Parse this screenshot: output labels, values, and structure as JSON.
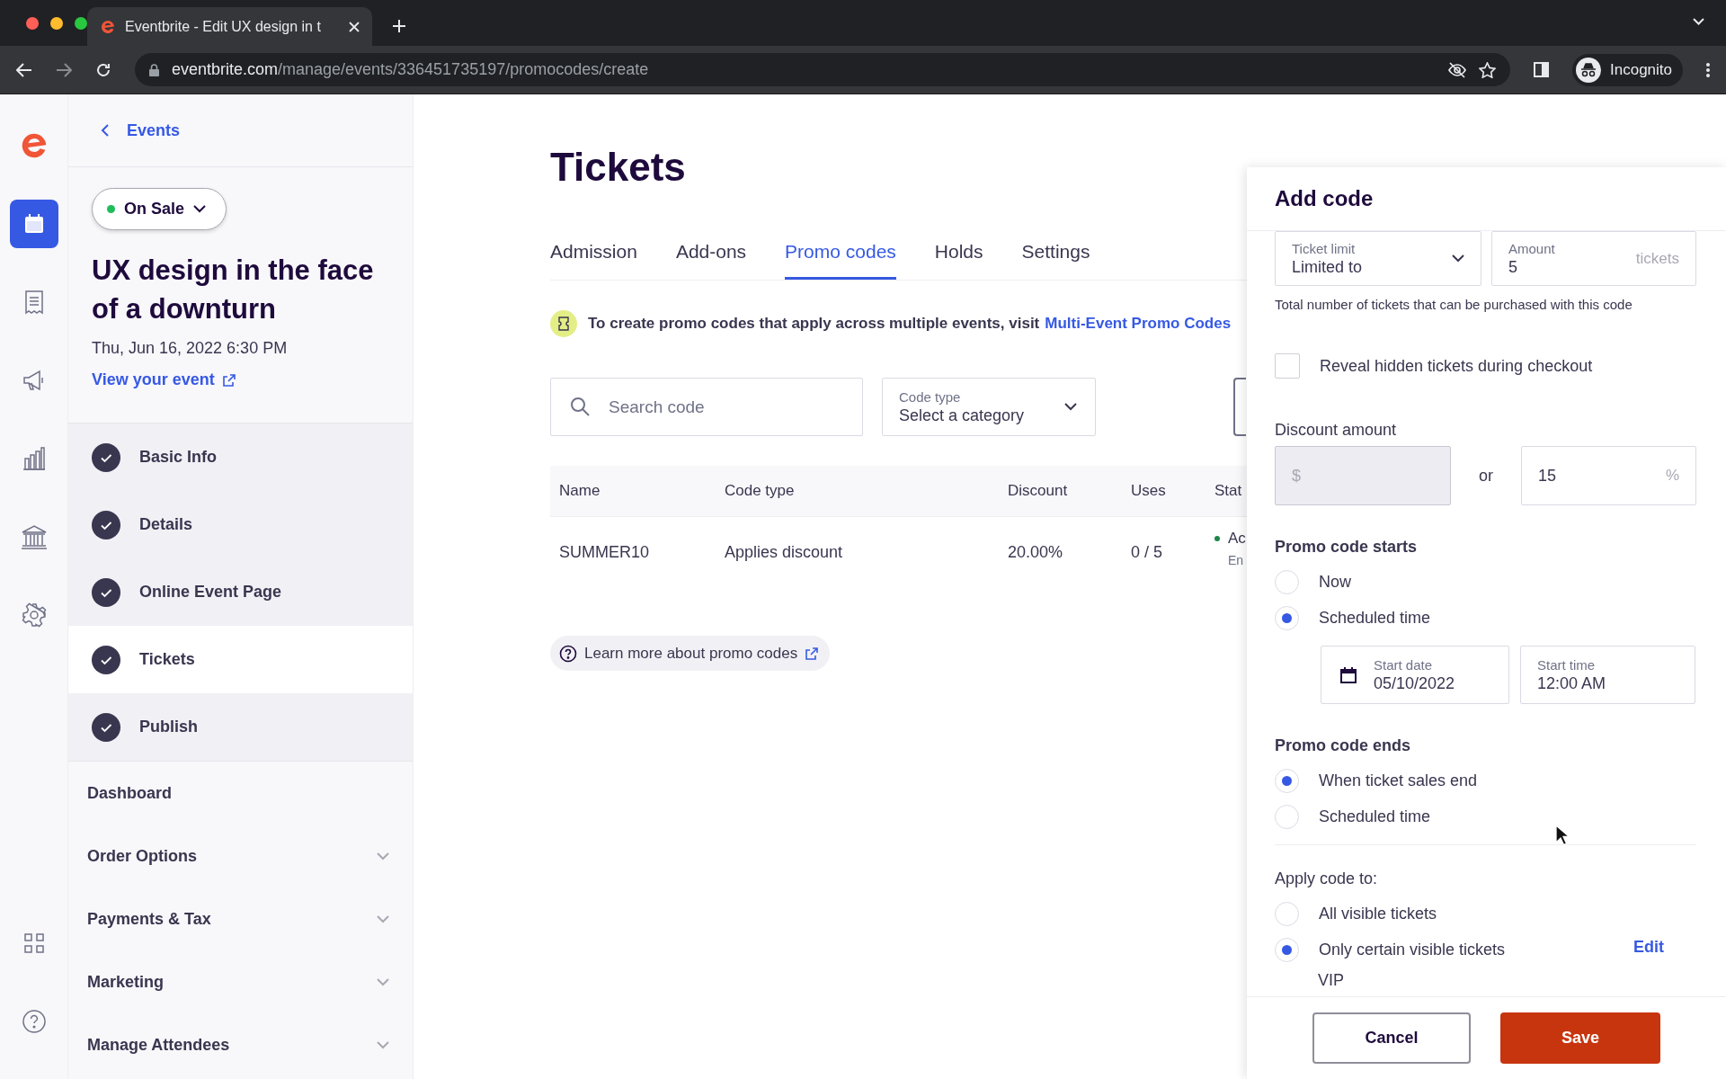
{
  "browser": {
    "tab_title": "Eventbrite - Edit UX design in t",
    "url_host": "eventbrite.com",
    "url_path": "/manage/events/336451735197/promocodes/create",
    "profile": "Incognito"
  },
  "rail": {
    "top": [
      {
        "kind": "calendar",
        "selected": true
      },
      {
        "kind": "receipt",
        "selected": false
      },
      {
        "kind": "megaphone",
        "selected": false
      },
      {
        "kind": "chart",
        "selected": false
      },
      {
        "kind": "bank",
        "selected": false
      },
      {
        "kind": "gear",
        "selected": false
      }
    ],
    "bottom": [
      {
        "kind": "grid",
        "selected": false
      },
      {
        "kind": "help",
        "selected": false
      }
    ]
  },
  "sidebar": {
    "back_link": "Events",
    "status": "On Sale",
    "event_title": "UX design in the face of a downturn",
    "event_date": "Thu, Jun 16, 2022 6:30 PM",
    "view_link": "View your event",
    "steps": [
      {
        "label": "Basic Info",
        "done": true,
        "selected": false
      },
      {
        "label": "Details",
        "done": true,
        "selected": false
      },
      {
        "label": "Online Event Page",
        "done": true,
        "selected": false
      },
      {
        "label": "Tickets",
        "done": true,
        "selected": true
      },
      {
        "label": "Publish",
        "done": true,
        "selected": false
      }
    ],
    "menu": [
      {
        "label": "Dashboard",
        "expandable": false
      },
      {
        "label": "Order Options",
        "expandable": true
      },
      {
        "label": "Payments & Tax",
        "expandable": true
      },
      {
        "label": "Marketing",
        "expandable": true
      },
      {
        "label": "Manage Attendees",
        "expandable": true
      }
    ]
  },
  "main": {
    "title": "Tickets",
    "tabs": [
      {
        "label": "Admission",
        "selected": false
      },
      {
        "label": "Add-ons",
        "selected": false
      },
      {
        "label": "Promo codes",
        "selected": true
      },
      {
        "label": "Holds",
        "selected": false
      },
      {
        "label": "Settings",
        "selected": false
      }
    ],
    "notice": {
      "text": "To create promo codes that apply across multiple events, visit",
      "link": "Multi-Event Promo Codes"
    },
    "search": {
      "placeholder": "Search code"
    },
    "code_type": {
      "label": "Code type",
      "value": "Select a category"
    },
    "table": {
      "columns": [
        "Name",
        "Code type",
        "Discount",
        "Uses",
        "Stat"
      ],
      "rows": [
        {
          "cells": [
            "SUMMER10",
            "Applies discount",
            "20.00%",
            "0 / 5"
          ],
          "status": "Ac",
          "status_sub": "En"
        }
      ]
    },
    "learn_more": "Learn more about promo codes"
  },
  "panel": {
    "title": "Add code",
    "ticket_limit": {
      "label": "Ticket limit",
      "value": "Limited to"
    },
    "amount": {
      "label": "Amount",
      "value": "5",
      "suffix": "tickets"
    },
    "limit_help": "Total number of tickets that can be purchased with this code",
    "reveal": {
      "label": "Reveal hidden tickets during checkout",
      "checked": false
    },
    "discount": {
      "label": "Discount amount",
      "dollar_prefix": "$",
      "dollar_disabled": true,
      "or": "or",
      "percent_value": "15",
      "percent_suffix": "%"
    },
    "starts": {
      "label": "Promo code starts",
      "options": [
        {
          "label": "Now",
          "selected": false
        },
        {
          "label": "Scheduled time",
          "selected": true
        }
      ]
    },
    "start_date": {
      "label": "Start date",
      "value": "05/10/2022"
    },
    "start_time": {
      "label": "Start time",
      "value": "12:00 AM"
    },
    "ends": {
      "label": "Promo code ends",
      "options": [
        {
          "label": "When ticket sales end",
          "selected": true
        },
        {
          "label": "Scheduled time",
          "selected": false
        }
      ]
    },
    "apply": {
      "label": "Apply code to:",
      "options": [
        {
          "label": "All visible tickets",
          "selected": false
        },
        {
          "label": "Only certain visible tickets",
          "selected": true
        }
      ],
      "edit": "Edit"
    },
    "ticket_name": "VIP",
    "cancel": "Cancel",
    "save": "Save"
  }
}
